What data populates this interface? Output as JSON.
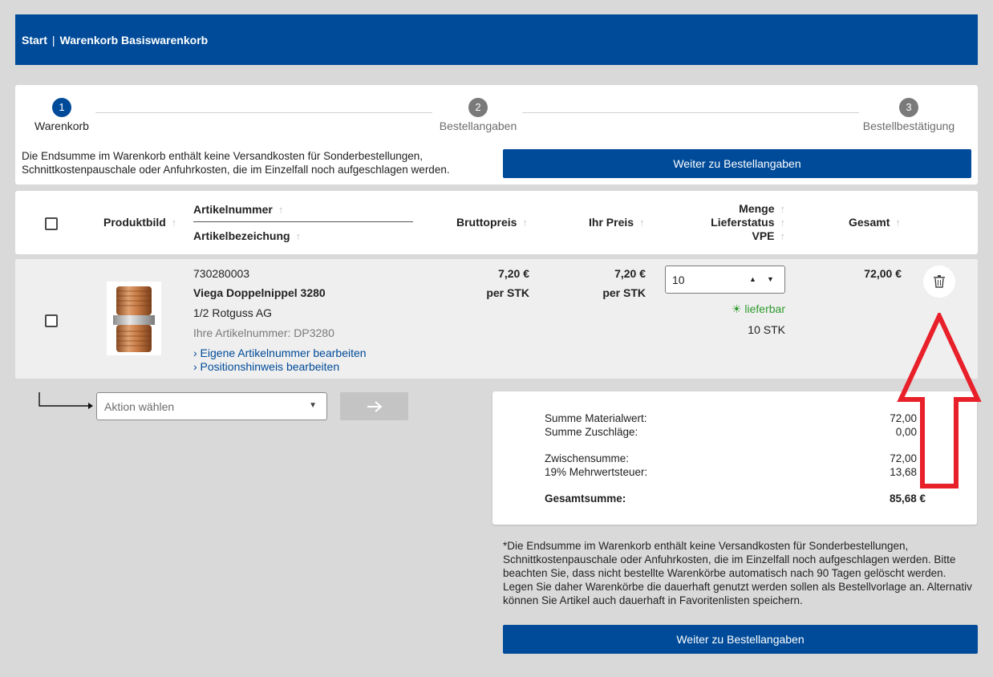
{
  "breadcrumb": {
    "home": "Start",
    "separator": "|",
    "current": "Warenkorb Basiswarenkorb"
  },
  "steps": [
    {
      "num": "1",
      "label": "Warenkorb",
      "state": "active"
    },
    {
      "num": "2",
      "label": "Bestellangaben",
      "state": "inactive"
    },
    {
      "num": "3",
      "label": "Bestellbestätigung",
      "state": "inactive"
    }
  ],
  "notice": "Die Endsumme im Warenkorb enthält keine Versandkosten für Sonderbestellungen, Schnittkostenpauschale oder Anfuhrkosten, die im Einzelfall noch aufgeschlagen werden.",
  "continue_button": "Weiter zu Bestellangaben",
  "table_headers": {
    "image": "Produktbild",
    "article_number": "Artikelnummer",
    "article_name": "Artikelbezeichung",
    "gross_price": "Bruttopreis",
    "your_price": "Ihr Preis",
    "quantity": "Menge",
    "delivery_status": "Lieferstatus",
    "pack_unit": "VPE",
    "total": "Gesamt",
    "sort_icon": "↑"
  },
  "item": {
    "article_number": "730280003",
    "name": "Viega Doppelnippel 3280",
    "description": "1/2 Rotguss AG",
    "customer_article_number": "Ihre Artikelnummer: DP3280",
    "edit_article_number_link": "› Eigene Artikelnummer bearbeiten",
    "edit_position_note_link": "› Positionshinweis bearbeiten",
    "gross_price": "7,20 €",
    "gross_unit": "per STK",
    "your_price": "7,20 €",
    "your_unit": "per STK",
    "quantity": "10",
    "availability": "lieferbar",
    "pack_unit": "10 STK",
    "total": "72,00 €"
  },
  "action_select": {
    "placeholder": "Aktion wählen"
  },
  "summary": {
    "material_label": "Summe Materialwert:",
    "material_value": "72,00",
    "surcharge_label": "Summe Zuschläge:",
    "surcharge_value": "0,00",
    "subtotal_label": "Zwischensumme:",
    "subtotal_value": "72,00",
    "vat_label": "19% Mehrwertsteuer:",
    "vat_value": "13,68",
    "grand_total_label": "Gesamtsumme:",
    "grand_total_value": "85,68 €"
  },
  "footnote": "*Die Endsumme im Warenkorb enthält keine Versandkosten für Sonderbestellungen, Schnittkostenpauschale oder Anfuhrkosten, die im Einzelfall noch aufgeschlagen werden. Bitte beachten Sie, dass nicht bestellte Warenkörbe automatisch nach 90 Tagen gelöscht werden. Legen Sie daher Warenkörbe die dauerhaft genutzt werden sollen als Bestellvorlage an. Alternativ können Sie Artikel auch dauerhaft in Favoritenlisten speichern.",
  "colors": {
    "brand": "#004b99",
    "available": "#2e9b2e",
    "annotation": "#e8202a"
  }
}
